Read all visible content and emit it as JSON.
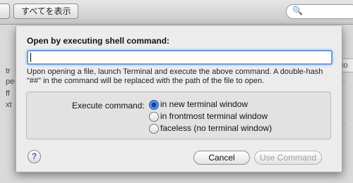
{
  "toolbar": {
    "show_all_label": "すべてを表示",
    "search_icon": "magnifier-icon",
    "search_glyph": "🔍"
  },
  "sheet": {
    "title": "Open by executing shell command:",
    "command_value": "",
    "description": "Upon opening a file, launch Terminal and execute the above command. A double-hash \"##\" in the command will be replaced with the path of the file to open.",
    "execute_label": "Execute command:",
    "options": [
      {
        "label": "in new terminal window",
        "selected": true
      },
      {
        "label": "in frontmost terminal window",
        "selected": false
      },
      {
        "label": "faceless (no terminal window)",
        "selected": false
      }
    ],
    "help_label": "?",
    "cancel_label": "Cancel",
    "use_command_label": "Use Command"
  },
  "colors": {
    "accent": "#2d6bd8",
    "disabled_text": "#a0a0a0"
  }
}
